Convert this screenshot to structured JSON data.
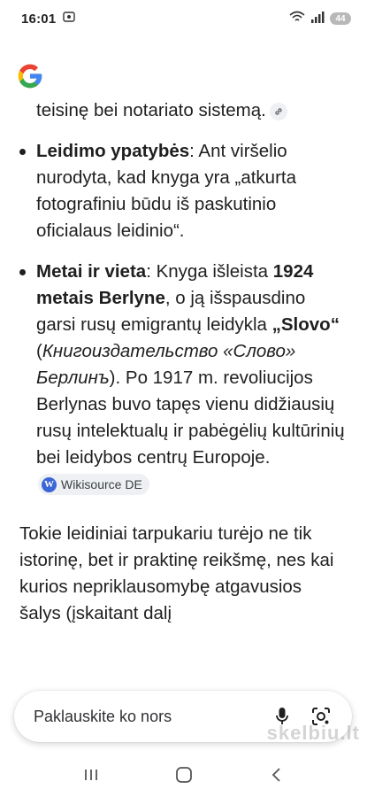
{
  "status_bar": {
    "time": "16:01",
    "battery": "44"
  },
  "content": {
    "bullet_partial": {
      "text": "teisinę bei notariato sistemą."
    },
    "bullets": [
      {
        "title": "Leidimo ypatybės",
        "text": ": Ant viršelio nurodyta, kad knyga yra „atkurta fotografiniu būdu iš paskutinio oficialaus leidinio“."
      },
      {
        "title": "Metai ir vieta",
        "text_1": ": Knyga išleista ",
        "bold_1": "1924 metais Berlyne",
        "text_2": ", o ją išspausdino garsi rusų emigrantų leidykla ",
        "bold_2": "„Slovo“",
        "text_3": " (",
        "italic_1": "Книгоиздательство «Слово» Берлинъ",
        "text_4": "). Po 1917 m. revoliucijos Berlynas buvo tapęs vienu didžiausių rusų intelektualų ir pabėgėlių kultūrinių bei leidybos centrų Europoje.",
        "source_label": "Wikisource DE"
      }
    ],
    "paragraph": "Tokie leidiniai tarpukariu turėjo ne tik istorinę, bet ir praktinę reikšmę, nes kai kurios nepriklausomybę atgavusios šalys (įskaitant dalį"
  },
  "search": {
    "placeholder": "Paklauskite ko nors"
  },
  "watermark": "skelbiu.lt",
  "colors": {
    "text": "#1f1f1f",
    "chip_bg": "#eef0f3",
    "google_blue": "#4285F4",
    "google_red": "#EA4335",
    "google_yellow": "#FBBC05",
    "google_green": "#34A853"
  }
}
